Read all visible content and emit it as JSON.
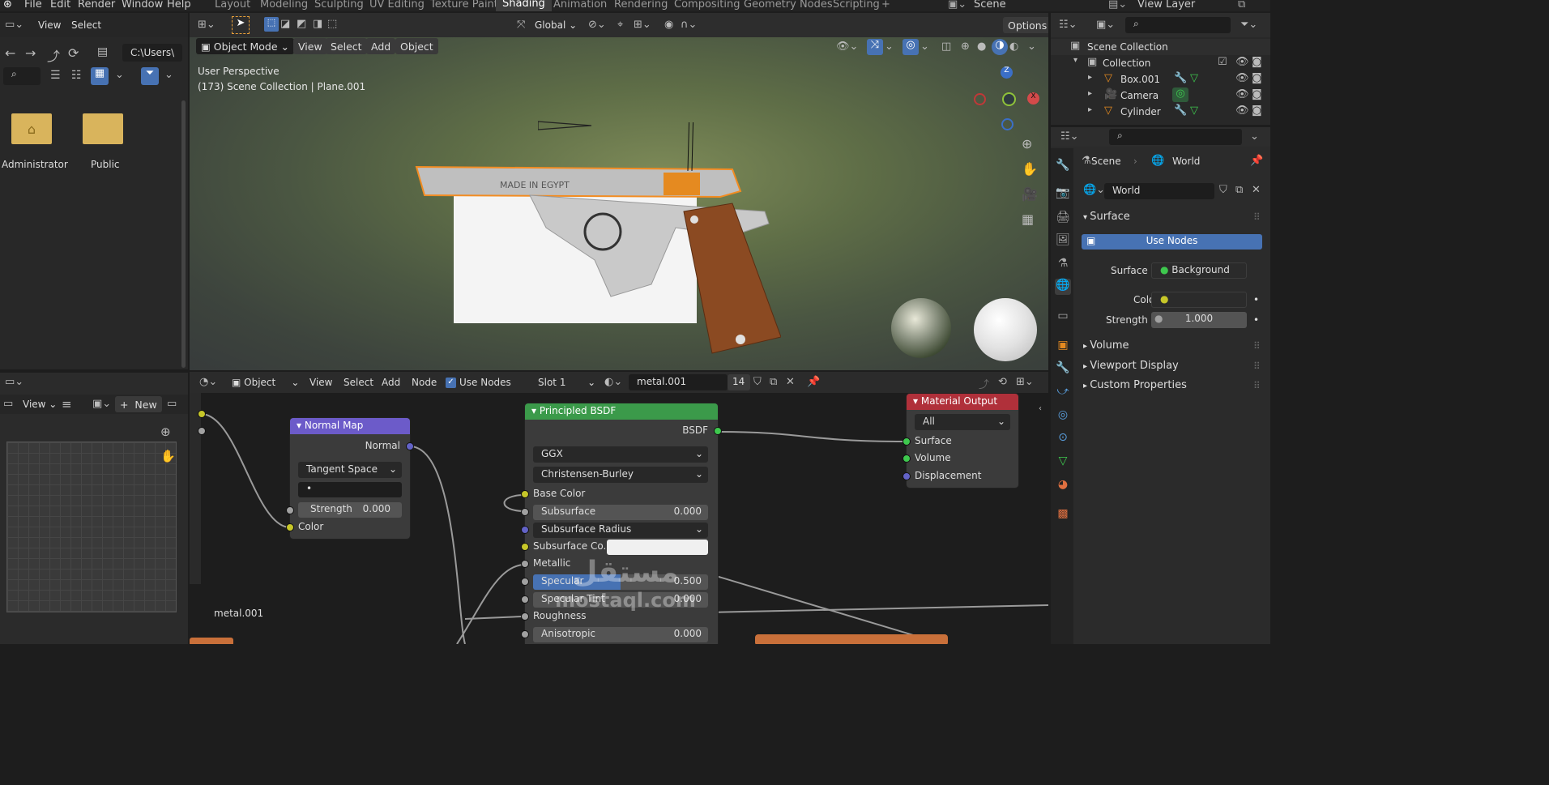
{
  "menu": {
    "file": "File",
    "edit": "Edit",
    "render": "Render",
    "window": "Window",
    "help": "Help"
  },
  "workspaces": [
    "Layout",
    "Modeling",
    "Sculpting",
    "UV Editing",
    "Texture Paint",
    "Shading",
    "Animation",
    "Rendering",
    "Compositing",
    "Geometry Nodes",
    "Scripting"
  ],
  "active_workspace": "Shading",
  "scene_name": "Scene",
  "view_layer": "View Layer",
  "filebrowser": {
    "view": "View",
    "select": "Select",
    "path": "C:\\Users\\",
    "folders": [
      "Administrator",
      "Public"
    ]
  },
  "viewport": {
    "mode": "Object Mode",
    "view": "View",
    "select": "Select",
    "add": "Add",
    "object": "Object",
    "orientation": "Global",
    "options": "Options",
    "overlay_line1": "User Perspective",
    "overlay_line2": "(173) Scene Collection | Plane.001",
    "decal_text": "MADE IN EGYPT"
  },
  "image_editor": {
    "view": "View",
    "new": "New"
  },
  "node_editor": {
    "type": "Object",
    "view": "View",
    "select": "Select",
    "add": "Add",
    "node": "Node",
    "use_nodes": "Use Nodes",
    "slot": "Slot 1",
    "material": "metal.001",
    "users": "14",
    "footer_material": "metal.001"
  },
  "normal_map": {
    "title": "Normal Map",
    "out": "Normal",
    "space": "Tangent Space",
    "uvmap": "•",
    "strength_label": "Strength",
    "strength": "0.000",
    "color": "Color"
  },
  "bsdf": {
    "title": "Principled BSDF",
    "out": "BSDF",
    "distribution": "GGX",
    "sss_method": "Christensen-Burley",
    "base_color": "Base Color",
    "subsurface": "Subsurface",
    "subsurface_val": "0.000",
    "subsurface_radius": "Subsurface Radius",
    "subsurface_color": "Subsurface Co...",
    "metallic": "Metallic",
    "specular": "Specular",
    "specular_val": "0.500",
    "specular_tint": "Specular Tint",
    "specular_tint_val": "0.000",
    "roughness": "Roughness",
    "anisotropic": "Anisotropic",
    "anisotropic_val": "0.000"
  },
  "mat_output": {
    "title": "Material Output",
    "target": "All",
    "surface": "Surface",
    "volume": "Volume",
    "displacement": "Displacement"
  },
  "outliner": {
    "root": "Scene Collection",
    "collection": "Collection",
    "items": [
      "Box.001",
      "Camera",
      "Cylinder"
    ]
  },
  "properties": {
    "crumb_scene": "Scene",
    "crumb_world": "World",
    "world": "World",
    "surface_panel": "Surface",
    "use_nodes": "Use Nodes",
    "surface_label": "Surface",
    "surface_value": "Background",
    "color_label": "Color",
    "strength_label": "Strength",
    "strength_value": "1.000",
    "volume": "Volume",
    "viewport_display": "Viewport Display",
    "custom_props": "Custom Properties"
  },
  "watermark": {
    "line1": "مستقل",
    "line2": "mostaql.com"
  },
  "colors": {
    "accent": "#4772b3",
    "shader_green": "#3b9a4a",
    "output_red": "#b0303a",
    "vector_purple": "#6c5bc9",
    "socket_yellow": "#c7c729",
    "socket_grey": "#a1a1a1",
    "socket_blue": "#6363c7",
    "socket_green": "#3ec84e"
  }
}
